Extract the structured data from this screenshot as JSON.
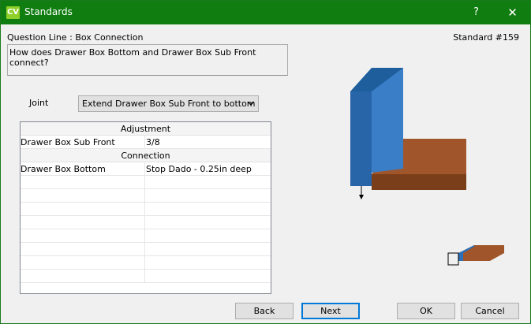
{
  "window": {
    "icon_text": "CV",
    "title": "Standards",
    "help_label": "?",
    "close_label": "✕"
  },
  "question": {
    "line_label": "Question Line : Box Connection",
    "standard_label": "Standard #159",
    "text": "How does Drawer Box Bottom and Drawer Box Sub Front connect?"
  },
  "joint": {
    "label": "Joint",
    "selected": "Extend Drawer Box Sub Front to bottom of"
  },
  "grid": {
    "adjustment_header": "Adjustment",
    "adjustment_row": {
      "name": "Drawer Box Sub Front",
      "value": "3/8"
    },
    "connection_header": "Connection",
    "connection_row": {
      "name": "Drawer Box Bottom",
      "value": "Stop Dado - 0.25in deep"
    }
  },
  "buttons": {
    "back": "Back",
    "next": "Next",
    "ok": "OK",
    "cancel": "Cancel"
  },
  "colors": {
    "titlebar": "#0f7d0f",
    "panel_blue": "#2e6fb5",
    "panel_wood": "#a0562a"
  }
}
